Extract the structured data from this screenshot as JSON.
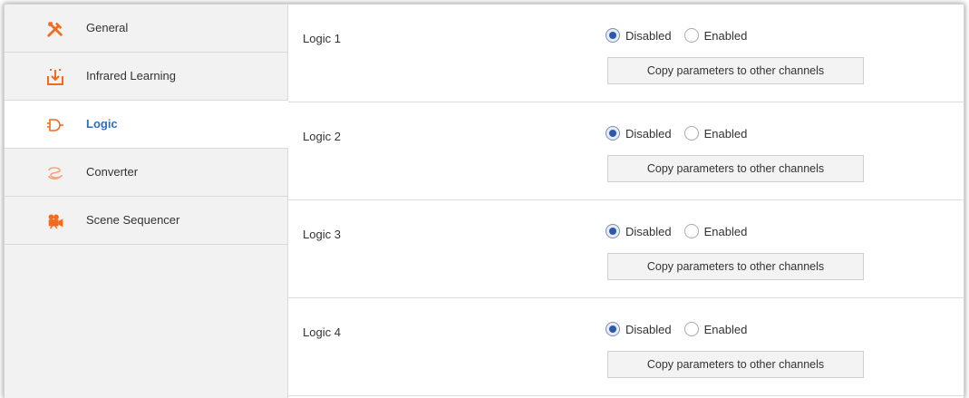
{
  "sidebar": {
    "items": [
      {
        "label": "General",
        "icon": "tools-icon"
      },
      {
        "label": "Infrared Learning",
        "icon": "download-tray-icon"
      },
      {
        "label": "Logic",
        "icon": "logic-gate-icon",
        "active": true
      },
      {
        "label": "Converter",
        "icon": "converter-icon"
      },
      {
        "label": "Scene Sequencer",
        "icon": "movie-camera-icon"
      }
    ]
  },
  "channels": [
    {
      "label": "Logic 1",
      "disabled_label": "Disabled",
      "enabled_label": "Enabled",
      "selected": "Disabled",
      "copy_label": "Copy parameters  to other channels"
    },
    {
      "label": "Logic 2",
      "disabled_label": "Disabled",
      "enabled_label": "Enabled",
      "selected": "Disabled",
      "copy_label": "Copy parameters  to other channels"
    },
    {
      "label": "Logic 3",
      "disabled_label": "Disabled",
      "enabled_label": "Enabled",
      "selected": "Disabled",
      "copy_label": "Copy parameters  to other channels"
    },
    {
      "label": "Logic 4",
      "disabled_label": "Disabled",
      "enabled_label": "Enabled",
      "selected": "Disabled",
      "copy_label": "Copy parameters  to other channels"
    }
  ],
  "colors": {
    "accent": "#2f6fb5",
    "icon_orange": "#f26b1d",
    "sidebar_bg": "#f2f2f2"
  }
}
